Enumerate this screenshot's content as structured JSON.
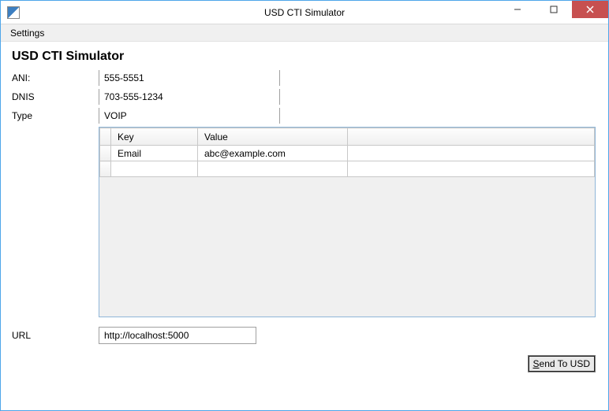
{
  "window": {
    "title": "USD CTI Simulator"
  },
  "menu": {
    "settings": "Settings"
  },
  "heading": "USD CTI Simulator",
  "fields": {
    "ani": {
      "label": "ANI:",
      "value": "555-5551"
    },
    "dnis": {
      "label": "DNIS",
      "value": "703-555-1234"
    },
    "type": {
      "label": "Type",
      "value": "VOIP"
    },
    "url": {
      "label": "URL",
      "value": "http://localhost:5000"
    }
  },
  "grid": {
    "headers": {
      "key": "Key",
      "value": "Value"
    },
    "rows": [
      {
        "key": "Email",
        "value": "abc@example.com"
      },
      {
        "key": "",
        "value": ""
      }
    ]
  },
  "buttons": {
    "send": "Send To USD"
  }
}
